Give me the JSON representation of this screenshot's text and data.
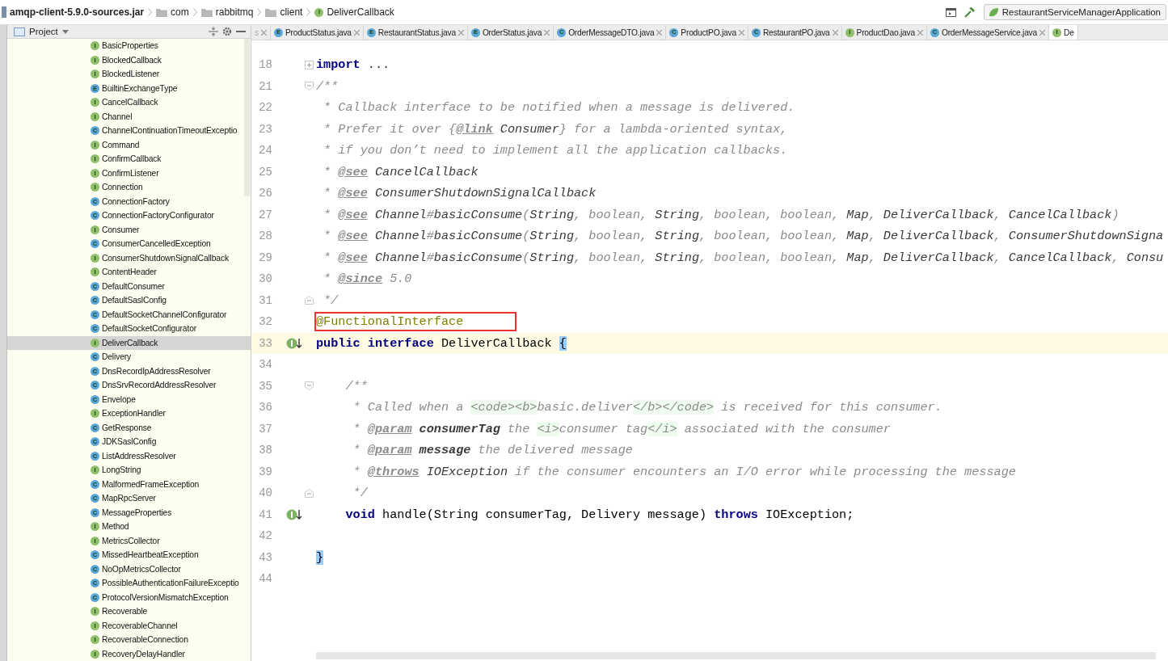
{
  "breadcrumb": {
    "jar": "amqp-client-5.9.0-sources.jar",
    "folders": [
      "com",
      "rabbitmq",
      "client"
    ],
    "file": {
      "name": "DeliverCallback",
      "kind": "interface",
      "letter": "I"
    }
  },
  "run_config": "RestaurantServiceManagerApplication",
  "project_panel": {
    "title": "Project",
    "items": [
      {
        "name": "BasicProperties",
        "kind": "interface",
        "letter": "I",
        "selected": false
      },
      {
        "name": "BlockedCallback",
        "kind": "interface",
        "letter": "I",
        "selected": false
      },
      {
        "name": "BlockedListener",
        "kind": "interface",
        "letter": "I",
        "selected": false
      },
      {
        "name": "BuiltinExchangeType",
        "kind": "enum",
        "letter": "E",
        "selected": false
      },
      {
        "name": "CancelCallback",
        "kind": "interface",
        "letter": "I",
        "selected": false
      },
      {
        "name": "Channel",
        "kind": "interface",
        "letter": "I",
        "selected": false
      },
      {
        "name": "ChannelContinuationTimeoutExceptio",
        "kind": "class",
        "letter": "C",
        "selected": false
      },
      {
        "name": "Command",
        "kind": "interface",
        "letter": "I",
        "selected": false
      },
      {
        "name": "ConfirmCallback",
        "kind": "interface",
        "letter": "I",
        "selected": false
      },
      {
        "name": "ConfirmListener",
        "kind": "interface",
        "letter": "I",
        "selected": false
      },
      {
        "name": "Connection",
        "kind": "interface",
        "letter": "I",
        "selected": false
      },
      {
        "name": "ConnectionFactory",
        "kind": "class",
        "letter": "C",
        "selected": false
      },
      {
        "name": "ConnectionFactoryConfigurator",
        "kind": "class",
        "letter": "C",
        "selected": false
      },
      {
        "name": "Consumer",
        "kind": "interface",
        "letter": "I",
        "selected": false
      },
      {
        "name": "ConsumerCancelledException",
        "kind": "class",
        "letter": "C",
        "selected": false
      },
      {
        "name": "ConsumerShutdownSignalCallback",
        "kind": "interface",
        "letter": "I",
        "selected": false
      },
      {
        "name": "ContentHeader",
        "kind": "interface",
        "letter": "I",
        "selected": false
      },
      {
        "name": "DefaultConsumer",
        "kind": "class",
        "letter": "C",
        "selected": false
      },
      {
        "name": "DefaultSaslConfig",
        "kind": "class",
        "letter": "C",
        "selected": false
      },
      {
        "name": "DefaultSocketChannelConfigurator",
        "kind": "class",
        "letter": "C",
        "selected": false
      },
      {
        "name": "DefaultSocketConfigurator",
        "kind": "class",
        "letter": "C",
        "selected": false
      },
      {
        "name": "DeliverCallback",
        "kind": "interface",
        "letter": "I",
        "selected": true
      },
      {
        "name": "Delivery",
        "kind": "class",
        "letter": "C",
        "selected": false
      },
      {
        "name": "DnsRecordIpAddressResolver",
        "kind": "class",
        "letter": "C",
        "selected": false
      },
      {
        "name": "DnsSrvRecordAddressResolver",
        "kind": "class",
        "letter": "C",
        "selected": false
      },
      {
        "name": "Envelope",
        "kind": "class",
        "letter": "C",
        "selected": false
      },
      {
        "name": "ExceptionHandler",
        "kind": "interface",
        "letter": "I",
        "selected": false
      },
      {
        "name": "GetResponse",
        "kind": "class",
        "letter": "C",
        "selected": false
      },
      {
        "name": "JDKSaslConfig",
        "kind": "class",
        "letter": "C",
        "selected": false
      },
      {
        "name": "ListAddressResolver",
        "kind": "class",
        "letter": "C",
        "selected": false
      },
      {
        "name": "LongString",
        "kind": "interface",
        "letter": "I",
        "selected": false
      },
      {
        "name": "MalformedFrameException",
        "kind": "class",
        "letter": "C",
        "selected": false
      },
      {
        "name": "MapRpcServer",
        "kind": "class",
        "letter": "C",
        "selected": false
      },
      {
        "name": "MessageProperties",
        "kind": "class",
        "letter": "C",
        "selected": false
      },
      {
        "name": "Method",
        "kind": "interface",
        "letter": "I",
        "selected": false
      },
      {
        "name": "MetricsCollector",
        "kind": "interface",
        "letter": "I",
        "selected": false
      },
      {
        "name": "MissedHeartbeatException",
        "kind": "class",
        "letter": "C",
        "selected": false
      },
      {
        "name": "NoOpMetricsCollector",
        "kind": "class",
        "letter": "C",
        "selected": false
      },
      {
        "name": "PossibleAuthenticationFailureExceptio",
        "kind": "class",
        "letter": "C",
        "selected": false
      },
      {
        "name": "ProtocolVersionMismatchException",
        "kind": "class",
        "letter": "C",
        "selected": false
      },
      {
        "name": "Recoverable",
        "kind": "interface",
        "letter": "I",
        "selected": false
      },
      {
        "name": "RecoverableChannel",
        "kind": "interface",
        "letter": "I",
        "selected": false
      },
      {
        "name": "RecoverableConnection",
        "kind": "interface",
        "letter": "I",
        "selected": false
      },
      {
        "name": "RecoveryDelayHandler",
        "kind": "interface",
        "letter": "I",
        "selected": false
      }
    ]
  },
  "tabs": [
    {
      "label": "s",
      "kind": "cut",
      "selected": false
    },
    {
      "label": "ProductStatus.java",
      "kind": "enum",
      "letter": "E",
      "selected": false
    },
    {
      "label": "RestaurantStatus.java",
      "kind": "enum",
      "letter": "E",
      "selected": false
    },
    {
      "label": "OrderStatus.java",
      "kind": "enum",
      "letter": "E",
      "selected": false
    },
    {
      "label": "OrderMessageDTO.java",
      "kind": "class",
      "letter": "C",
      "selected": false
    },
    {
      "label": "ProductPO.java",
      "kind": "class",
      "letter": "C",
      "selected": false
    },
    {
      "label": "RestaurantPO.java",
      "kind": "class",
      "letter": "C",
      "selected": false
    },
    {
      "label": "ProductDao.java",
      "kind": "interface",
      "letter": "I",
      "selected": false
    },
    {
      "label": "OrderMessageService.java",
      "kind": "class",
      "letter": "C",
      "selected": false
    },
    {
      "label": "De",
      "kind": "interface",
      "letter": "I",
      "selected": true
    }
  ],
  "editor": {
    "lines": [
      {
        "number": "18",
        "folded": true,
        "tokens": [
          {
            "kind": "keyword",
            "text": "import"
          },
          {
            "kind": "folded",
            "text": " ..."
          }
        ]
      },
      {
        "number": "21",
        "fold_start": true,
        "tokens": [
          {
            "kind": "comment",
            "text": "/**"
          }
        ]
      },
      {
        "number": "22",
        "tokens": [
          {
            "kind": "comment",
            "text": " * Callback interface to be notified when a message is delivered."
          }
        ]
      },
      {
        "number": "23",
        "tokens": [
          {
            "kind": "comment",
            "text": " * Prefer it over {"
          },
          {
            "kind": "doctag",
            "text": "@link"
          },
          {
            "kind": "docref",
            "text": " Consumer"
          },
          {
            "kind": "comment",
            "text": "} for a lambda-oriented syntax,"
          }
        ]
      },
      {
        "number": "24",
        "tokens": [
          {
            "kind": "comment",
            "text": " * if you don’t need to implement all the application callbacks."
          }
        ]
      },
      {
        "number": "25",
        "tokens": [
          {
            "kind": "comment",
            "text": " * "
          },
          {
            "kind": "doctag",
            "text": "@see"
          },
          {
            "kind": "docref",
            "text": " CancelCallback"
          }
        ]
      },
      {
        "number": "26",
        "tokens": [
          {
            "kind": "comment",
            "text": " * "
          },
          {
            "kind": "doctag",
            "text": "@see"
          },
          {
            "kind": "docref",
            "text": " ConsumerShutdownSignalCallback"
          }
        ]
      },
      {
        "number": "27",
        "tokens": [
          {
            "kind": "comment",
            "text": " * "
          },
          {
            "kind": "doctag",
            "text": "@see"
          },
          {
            "kind": "docref",
            "text": " Channel"
          },
          {
            "kind": "comment",
            "text": "#"
          },
          {
            "kind": "docref",
            "text": "basicConsume"
          },
          {
            "kind": "comment",
            "text": "("
          },
          {
            "kind": "docref",
            "text": "String"
          },
          {
            "kind": "comment",
            "text": ", boolean, "
          },
          {
            "kind": "docref",
            "text": "String"
          },
          {
            "kind": "comment",
            "text": ", boolean, boolean, "
          },
          {
            "kind": "docref",
            "text": "Map"
          },
          {
            "kind": "comment",
            "text": ", "
          },
          {
            "kind": "docref",
            "text": "DeliverCallback"
          },
          {
            "kind": "comment",
            "text": ", "
          },
          {
            "kind": "docref",
            "text": "CancelCallback"
          },
          {
            "kind": "comment",
            "text": ")"
          }
        ]
      },
      {
        "number": "28",
        "tokens": [
          {
            "kind": "comment",
            "text": " * "
          },
          {
            "kind": "doctag",
            "text": "@see"
          },
          {
            "kind": "docref",
            "text": " Channel"
          },
          {
            "kind": "comment",
            "text": "#"
          },
          {
            "kind": "docref",
            "text": "basicConsume"
          },
          {
            "kind": "comment",
            "text": "("
          },
          {
            "kind": "docref",
            "text": "String"
          },
          {
            "kind": "comment",
            "text": ", boolean, "
          },
          {
            "kind": "docref",
            "text": "String"
          },
          {
            "kind": "comment",
            "text": ", boolean, boolean, "
          },
          {
            "kind": "docref",
            "text": "Map"
          },
          {
            "kind": "comment",
            "text": ", "
          },
          {
            "kind": "docref",
            "text": "DeliverCallback"
          },
          {
            "kind": "comment",
            "text": ", "
          },
          {
            "kind": "docref",
            "text": "ConsumerShutdownSigna"
          }
        ]
      },
      {
        "number": "29",
        "tokens": [
          {
            "kind": "comment",
            "text": " * "
          },
          {
            "kind": "doctag",
            "text": "@see"
          },
          {
            "kind": "docref",
            "text": " Channel"
          },
          {
            "kind": "comment",
            "text": "#"
          },
          {
            "kind": "docref",
            "text": "basicConsume"
          },
          {
            "kind": "comment",
            "text": "("
          },
          {
            "kind": "docref",
            "text": "String"
          },
          {
            "kind": "comment",
            "text": ", boolean, "
          },
          {
            "kind": "docref",
            "text": "String"
          },
          {
            "kind": "comment",
            "text": ", boolean, boolean, "
          },
          {
            "kind": "docref",
            "text": "Map"
          },
          {
            "kind": "comment",
            "text": ", "
          },
          {
            "kind": "docref",
            "text": "DeliverCallback"
          },
          {
            "kind": "comment",
            "text": ", "
          },
          {
            "kind": "docref",
            "text": "CancelCallback"
          },
          {
            "kind": "comment",
            "text": ", "
          },
          {
            "kind": "docref",
            "text": "Consu"
          }
        ]
      },
      {
        "number": "30",
        "tokens": [
          {
            "kind": "comment",
            "text": " * "
          },
          {
            "kind": "doctag",
            "text": "@since"
          },
          {
            "kind": "comment",
            "text": " 5.0"
          }
        ]
      },
      {
        "number": "31",
        "fold_end": true,
        "tokens": [
          {
            "kind": "comment",
            "text": " */"
          }
        ]
      },
      {
        "number": "32",
        "boxed": true,
        "tokens": [
          {
            "kind": "annotation",
            "text": "@FunctionalInterface"
          }
        ]
      },
      {
        "number": "33",
        "gutter_marker": true,
        "caret_line": true,
        "tokens": [
          {
            "kind": "keyword",
            "text": "public"
          },
          {
            "kind": "keyword",
            "text": " interface"
          },
          {
            "kind": "plain",
            "text": " DeliverCallback "
          },
          {
            "kind": "brace",
            "text": "{"
          }
        ]
      },
      {
        "number": "34"
      },
      {
        "number": "35",
        "fold_start": true,
        "tokens": [
          {
            "kind": "comment",
            "text": "    /**"
          }
        ]
      },
      {
        "number": "36",
        "tokens": [
          {
            "kind": "comment",
            "text": "     * Called when a "
          },
          {
            "kind": "html",
            "text": "<code><b>"
          },
          {
            "kind": "comment",
            "text": "basic.deliver"
          },
          {
            "kind": "html",
            "text": "</b></code>"
          },
          {
            "kind": "comment",
            "text": " is received for this consumer."
          }
        ]
      },
      {
        "number": "37",
        "tokens": [
          {
            "kind": "comment",
            "text": "     * "
          },
          {
            "kind": "doctag",
            "text": "@param"
          },
          {
            "kind": "docparam",
            "text": " consumerTag"
          },
          {
            "kind": "comment",
            "text": " the "
          },
          {
            "kind": "html",
            "text": "<i>"
          },
          {
            "kind": "comment",
            "text": "consumer tag"
          },
          {
            "kind": "html",
            "text": "</i>"
          },
          {
            "kind": "comment",
            "text": " associated with the consumer"
          }
        ]
      },
      {
        "number": "38",
        "tokens": [
          {
            "kind": "comment",
            "text": "     * "
          },
          {
            "kind": "doctag",
            "text": "@param"
          },
          {
            "kind": "docparam",
            "text": " message"
          },
          {
            "kind": "comment",
            "text": " the delivered message"
          }
        ]
      },
      {
        "number": "39",
        "tokens": [
          {
            "kind": "comment",
            "text": "     * "
          },
          {
            "kind": "doctag",
            "text": "@throws"
          },
          {
            "kind": "docref",
            "text": " IOException"
          },
          {
            "kind": "comment",
            "text": " if the consumer encounters an I/O error while processing the message"
          }
        ]
      },
      {
        "number": "40",
        "fold_end": true,
        "tokens": [
          {
            "kind": "comment",
            "text": "     */"
          }
        ]
      },
      {
        "number": "41",
        "gutter_marker": true,
        "tokens": [
          {
            "kind": "keyword",
            "text": "    void"
          },
          {
            "kind": "plain",
            "text": " handle(String consumerTag, Delivery message) "
          },
          {
            "kind": "keyword",
            "text": "throws"
          },
          {
            "kind": "plain",
            "text": " IOException;"
          }
        ]
      },
      {
        "number": "42"
      },
      {
        "number": "43",
        "tokens": [
          {
            "kind": "brace",
            "text": "}"
          }
        ]
      },
      {
        "number": "44"
      }
    ]
  }
}
